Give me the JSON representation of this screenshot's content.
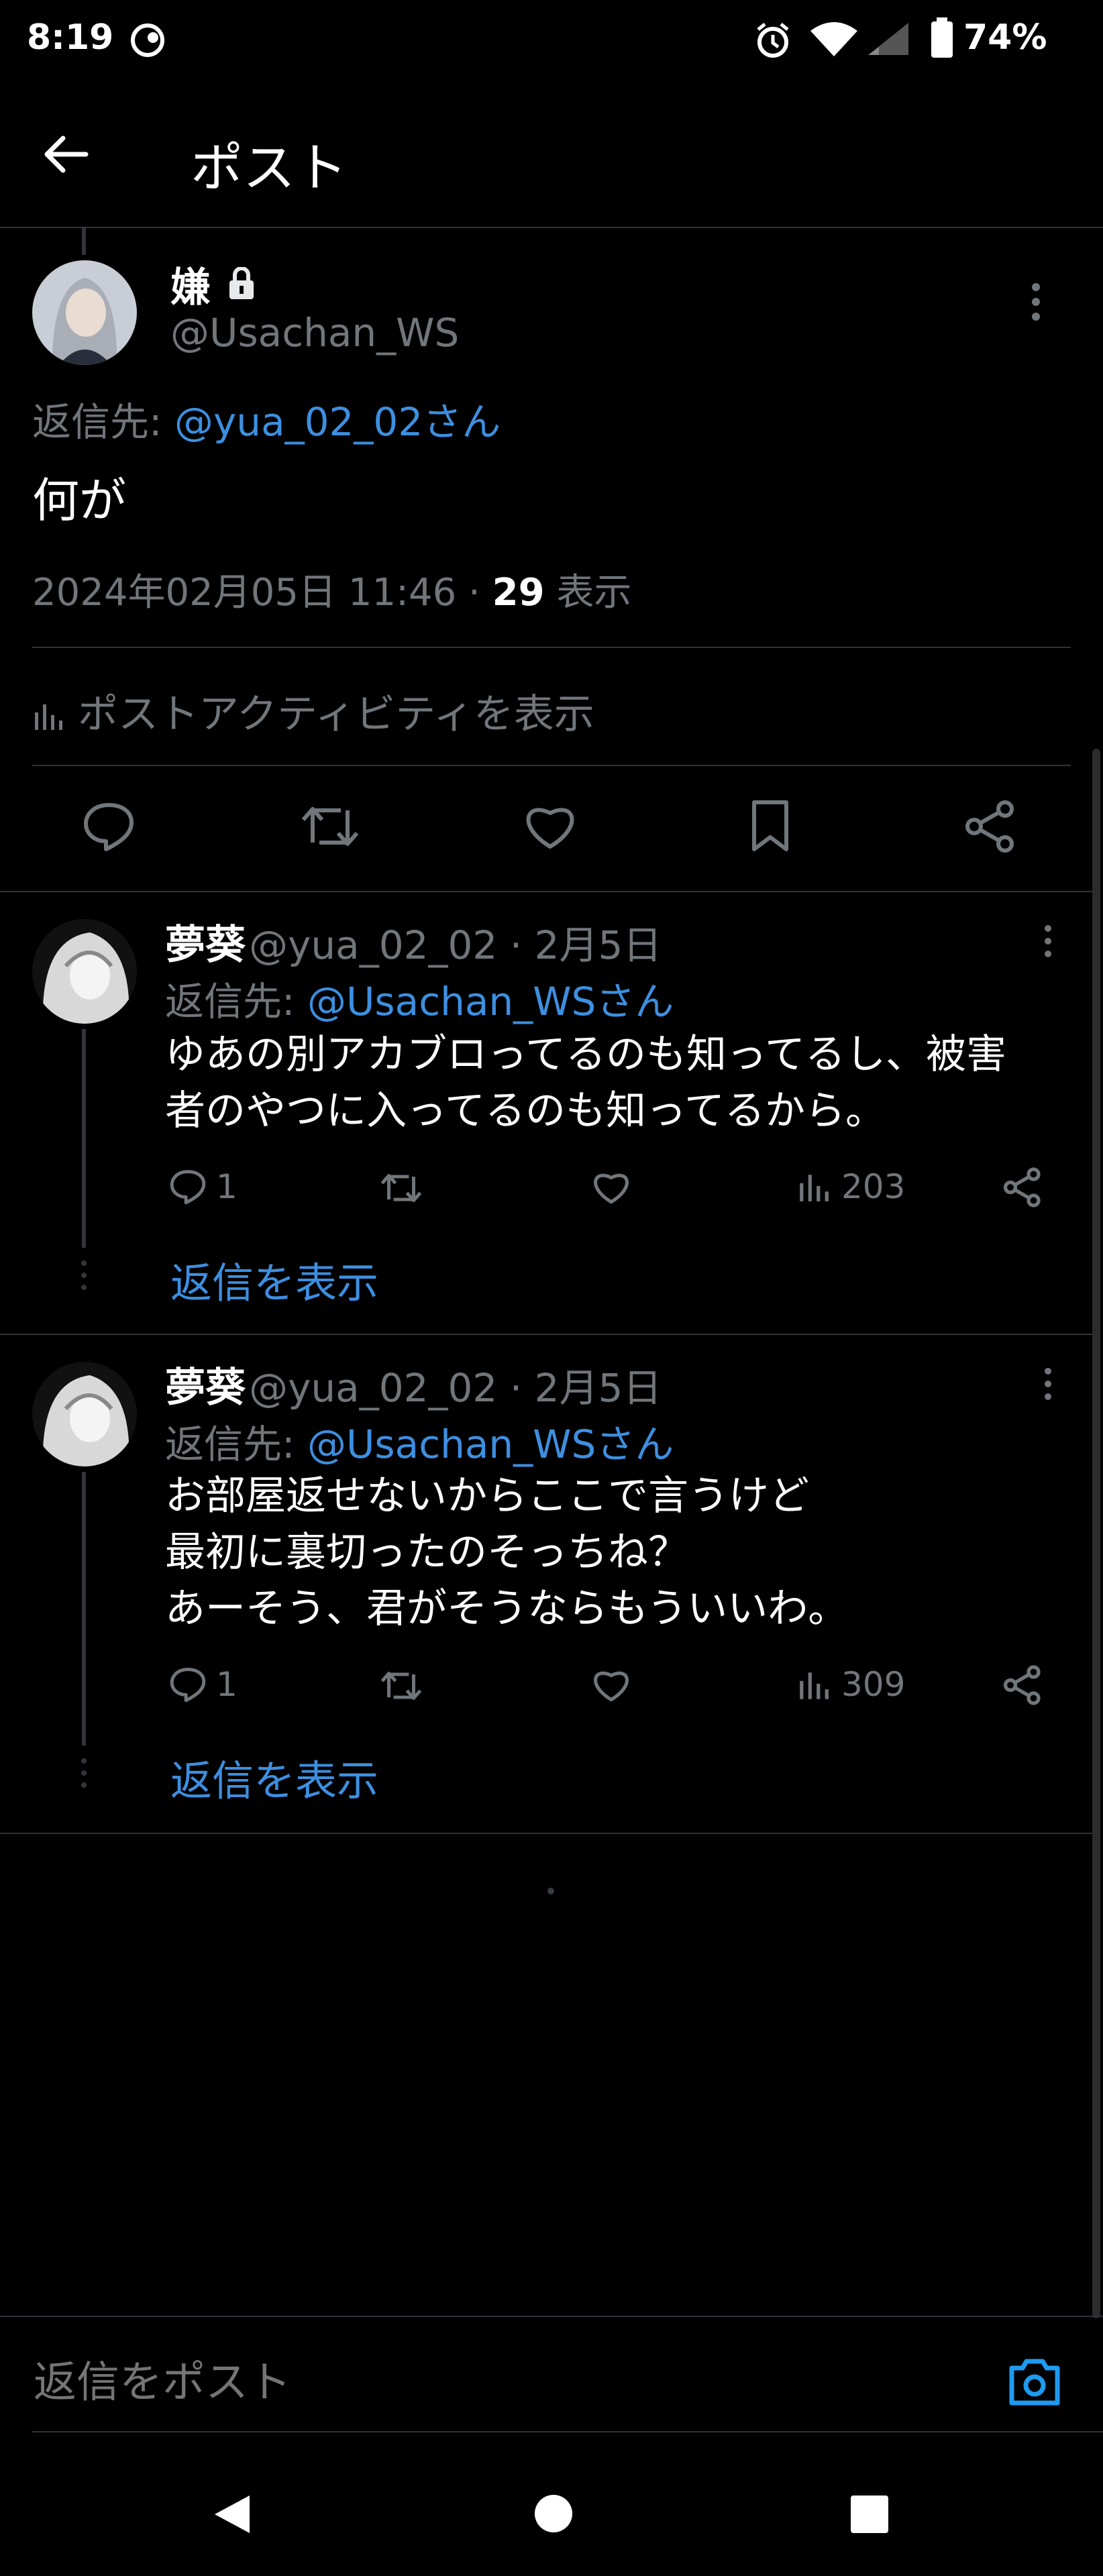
{
  "status_bar": {
    "time": "8:19",
    "battery_percent": "74%",
    "icons": [
      "notification-app-icon",
      "alarm-icon",
      "wifi-icon",
      "signal-icon",
      "battery-icon"
    ]
  },
  "header": {
    "title": "ポスト"
  },
  "main_post": {
    "author_name": "嫌",
    "author_handle": "@Usachan_WS",
    "reply_prefix": "返信先:",
    "reply_target": "@yua_02_02さん",
    "text": "何が",
    "datetime": "2024年02月05日 11:46 · ",
    "view_count": "29",
    "view_label": " 表示",
    "activity_label": "ポストアクティビティを表示",
    "actions": [
      "reply-icon",
      "retweet-icon",
      "like-icon",
      "bookmark-icon",
      "share-icon"
    ]
  },
  "replies": [
    {
      "name": "夢葵",
      "handle_date": "@yua_02_02 · 2月5日",
      "reply_prefix": "返信先:",
      "reply_target": "@Usachan_WSさん",
      "lines": [
        "ゆあの別アカブロってるのも知ってるし、被害",
        "者のやつに入ってるのも知ってるから。"
      ],
      "reply_count": "1",
      "views": "203",
      "show_replies": "返信を表示"
    },
    {
      "name": "夢葵",
      "handle_date": "@yua_02_02 · 2月5日",
      "reply_prefix": "返信先:",
      "reply_target": "@Usachan_WSさん",
      "lines": [
        "お部屋返せないからここで言うけど",
        "最初に裏切ったのそっちね？",
        "あーそう、君がそうならもういいわ。"
      ],
      "reply_count": "1",
      "views": "309",
      "show_replies": "返信を表示"
    }
  ],
  "reply_box": {
    "placeholder": "返信をポスト"
  },
  "colors": {
    "background": "#000000",
    "accent": "#1d9bf0",
    "text": "#e7e9ea",
    "muted": "#71767b",
    "divider": "#2f3336"
  }
}
